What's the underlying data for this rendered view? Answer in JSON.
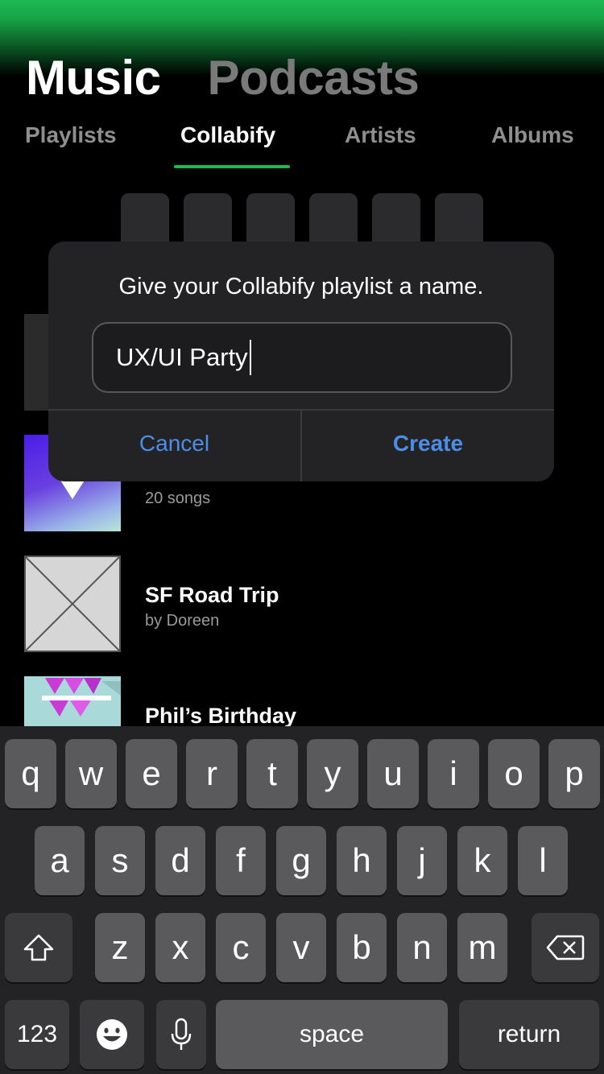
{
  "header": {
    "main_tabs": [
      {
        "label": "Music",
        "active": true
      },
      {
        "label": "Podcasts",
        "active": false
      }
    ],
    "sub_tabs": [
      {
        "label": "Playlists",
        "active": false
      },
      {
        "label": "Collabify",
        "active": true
      },
      {
        "label": "Artists",
        "active": false
      },
      {
        "label": "Albums",
        "active": false
      }
    ],
    "accent_color": "#1db954"
  },
  "playlists": [
    {
      "title": "",
      "subtitle": "20 songs"
    },
    {
      "title": "SF Road Trip",
      "subtitle": "by Doreen"
    },
    {
      "title": "Phil’s Birthday",
      "subtitle": ""
    }
  ],
  "dialog": {
    "title": "Give your Collabify playlist a name.",
    "input_value": "UX/UI Party",
    "cancel_label": "Cancel",
    "create_label": "Create",
    "button_color": "#4b8ee8"
  },
  "keyboard": {
    "row1": [
      "q",
      "w",
      "e",
      "r",
      "t",
      "y",
      "u",
      "i",
      "o",
      "p"
    ],
    "row2": [
      "a",
      "s",
      "d",
      "f",
      "g",
      "h",
      "j",
      "k",
      "l"
    ],
    "row3": [
      "z",
      "x",
      "c",
      "v",
      "b",
      "n",
      "m"
    ],
    "numbers_label": "123",
    "space_label": "space",
    "return_label": "return",
    "shift_icon": "shift-icon",
    "delete_icon": "backspace-icon",
    "emoji_icon": "emoji-icon",
    "mic_icon": "microphone-icon"
  }
}
